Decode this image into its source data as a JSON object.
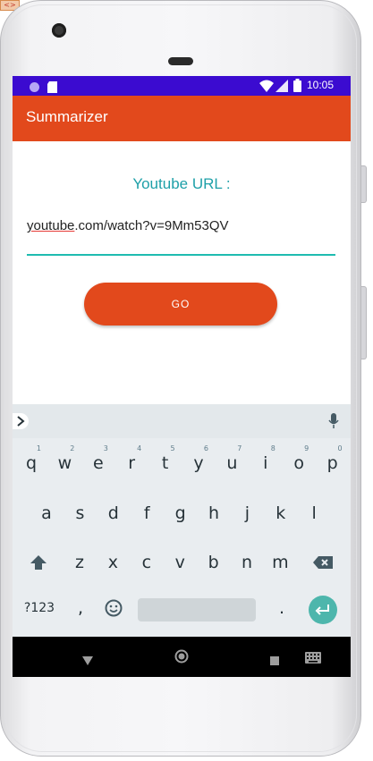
{
  "colors": {
    "status_bar": "#3b0bd0",
    "app_bar": "#e2491c",
    "label": "#1ea0a8",
    "input_line": "#1fbcb0",
    "enter_key": "#4db6ac"
  },
  "status_bar": {
    "time": "10:05",
    "icons": [
      "circle-icon",
      "sim-icon",
      "wifi-icon",
      "signal-icon",
      "battery-icon"
    ]
  },
  "app_bar": {
    "title": "Summarizer"
  },
  "form": {
    "label": "Youtube URL :",
    "url_value_underlined": "youtube",
    "url_value_rest": ".com/watch?v=9Mm53QV",
    "button_label": "GO"
  },
  "keyboard": {
    "row1": [
      {
        "k": "q",
        "h": "1"
      },
      {
        "k": "w",
        "h": "2"
      },
      {
        "k": "e",
        "h": "3"
      },
      {
        "k": "r",
        "h": "4"
      },
      {
        "k": "t",
        "h": "5"
      },
      {
        "k": "y",
        "h": "6"
      },
      {
        "k": "u",
        "h": "7"
      },
      {
        "k": "i",
        "h": "8"
      },
      {
        "k": "o",
        "h": "9"
      },
      {
        "k": "p",
        "h": "0"
      }
    ],
    "row2": [
      "a",
      "s",
      "d",
      "f",
      "g",
      "h",
      "j",
      "k",
      "l"
    ],
    "row3": [
      "z",
      "x",
      "c",
      "v",
      "b",
      "n",
      "m"
    ],
    "symbols_key": "?123",
    "comma_key": ",",
    "period_key": ".",
    "icons": [
      "chevron-right-icon",
      "mic-icon",
      "shift-icon",
      "backspace-icon",
      "emoji-icon",
      "enter-icon"
    ]
  },
  "nav_bar": {
    "icons": [
      "back-icon",
      "home-icon",
      "recents-icon",
      "keyboard-switch-icon"
    ]
  }
}
